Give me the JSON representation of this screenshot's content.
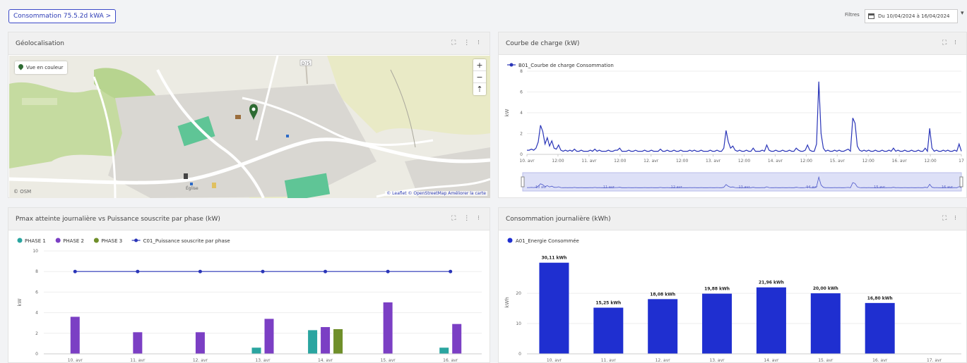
{
  "header": {
    "main_button": "Consommation 75.5.2d kWA >",
    "filter_label": "Filtres",
    "date_range": "Du 10/04/2024 à 16/04/2024"
  },
  "map_panel": {
    "title": "Géolocalisation",
    "tools": "⛶ ⋮ ⁝",
    "layer_button": "Vue en couleur",
    "zoom_in": "+",
    "zoom_out": "−",
    "reset": "⇡",
    "attribution": "© Leaflet © OpenStreetMap Améliorer la carte",
    "logo": "© OSM",
    "place_1": "D75",
    "place_2": "Église",
    "colors": {
      "land": "#ecebe3",
      "buildings": "#d9d7d2",
      "roads": "#ffffff",
      "green": "#c5dba0",
      "park": "#5fc596",
      "marker": "#2e6b33"
    }
  },
  "courbe_panel": {
    "title": "Courbe de charge (kW)",
    "tools": "⛶ ⁝",
    "ylabel": "kW",
    "legend": "B01_Courbe de charge Consommation",
    "y_ticks": [
      "0",
      "2",
      "4",
      "6",
      "8"
    ],
    "x_ticks": [
      "10. avr",
      "12:00",
      "11. avr",
      "12:00",
      "12. avr",
      "12:00",
      "13. avr",
      "12:00",
      "14. avr",
      "12:00",
      "15. avr",
      "12:00",
      "16. avr",
      "12:00",
      "17"
    ],
    "color": "#2a35b8",
    "navigator_ticks": [
      "10 avr",
      "11 avr",
      "12 avr",
      "13 avr",
      "14 avr",
      "15 avr",
      "16 avr"
    ]
  },
  "pmax_panel": {
    "title": "Pmax atteinte journalière vs Puissance souscrite par phase (kW)",
    "tools": "⛶ ⋮ ⁝",
    "ylabel": "kW",
    "legend": [
      {
        "name": "PHASE 1",
        "color": "#2aa5a0"
      },
      {
        "name": "PHASE 2",
        "color": "#7b3fc4"
      },
      {
        "name": "PHASE 3",
        "color": "#6f8f2a"
      },
      {
        "name": "C01_Puissance souscrite par phase",
        "color": "#2a35b8"
      }
    ],
    "y_ticks": [
      "0",
      "2",
      "4",
      "6",
      "8",
      "10"
    ],
    "x_ticks": [
      "10. avr",
      "11. avr",
      "12. avr",
      "13. avr",
      "14. avr",
      "15. avr",
      "16. avr"
    ]
  },
  "conso_panel": {
    "title": "Consommation journalière (kWh)",
    "tools": "⛶ ⁝",
    "ylabel": "kWh",
    "legend": "A01_Energie Consommée",
    "color": "#1f2fd0",
    "y_ticks": [
      "0",
      "10",
      "20"
    ],
    "x_ticks": [
      "10. avr",
      "11. avr",
      "12. avr",
      "13. avr",
      "14. avr",
      "15. avr",
      "16. avr",
      "17. avr"
    ],
    "bar_labels": [
      "30,11 kWh",
      "15,25 kWh",
      "18,08 kWh",
      "19,88 kWh",
      "21,96 kWh",
      "20,00 kWh",
      "16,80 kWh",
      ""
    ]
  },
  "chart_data": [
    {
      "type": "line",
      "title": "Courbe de charge (kW)",
      "ylabel": "kW",
      "ylim": [
        0,
        8
      ],
      "series": [
        {
          "name": "B01_Courbe de charge Consommation",
          "values": [
            0.4,
            0.4,
            0.5,
            0.4,
            0.6,
            1.2,
            2.8,
            2.2,
            1.0,
            1.6,
            0.8,
            1.3,
            0.6,
            0.5,
            0.9,
            0.4,
            0.3,
            0.4,
            0.3,
            0.4,
            0.3,
            0.5,
            0.3,
            0.3,
            0.4,
            0.3,
            0.3,
            0.3,
            0.4,
            0.3,
            0.5,
            0.3,
            0.4,
            0.3,
            0.3,
            0.3,
            0.4,
            0.3,
            0.3,
            0.4,
            0.4,
            0.6,
            0.3,
            0.3,
            0.3,
            0.4,
            0.3,
            0.3,
            0.4,
            0.3,
            0.3,
            0.3,
            0.4,
            0.3,
            0.3,
            0.4,
            0.3,
            0.3,
            0.3,
            0.5,
            0.3,
            0.3,
            0.4,
            0.3,
            0.3,
            0.4,
            0.3,
            0.3,
            0.4,
            0.3,
            0.3,
            0.3,
            0.4,
            0.3,
            0.4,
            0.3,
            0.3,
            0.4,
            0.3,
            0.3,
            0.3,
            0.4,
            0.3,
            0.3,
            0.4,
            0.3,
            0.3,
            0.6,
            2.3,
            1.2,
            0.6,
            0.8,
            0.4,
            0.3,
            0.4,
            0.3,
            0.3,
            0.4,
            0.3,
            0.3,
            0.6,
            0.3,
            0.3,
            0.3,
            0.4,
            0.3,
            0.9,
            0.4,
            0.3,
            0.3,
            0.4,
            0.3,
            0.3,
            0.4,
            0.3,
            0.3,
            0.4,
            0.3,
            0.3,
            0.6,
            0.4,
            0.3,
            0.3,
            0.4,
            0.9,
            0.4,
            0.3,
            0.3,
            1.0,
            7.0,
            2.0,
            0.6,
            0.3,
            0.4,
            0.3,
            0.3,
            0.4,
            0.3,
            0.4,
            0.3,
            0.3,
            0.4,
            0.5,
            0.3,
            3.5,
            3.0,
            0.8,
            0.4,
            0.3,
            0.4,
            0.3,
            0.4,
            0.3,
            0.3,
            0.4,
            0.3,
            0.3,
            0.4,
            0.3,
            0.3,
            0.4,
            0.3,
            0.6,
            0.3,
            0.4,
            0.3,
            0.3,
            0.4,
            0.3,
            0.3,
            0.4,
            0.3,
            0.3,
            0.4,
            0.3,
            0.3,
            0.6,
            0.3,
            2.5,
            0.6,
            0.3,
            0.4,
            0.3,
            0.3,
            0.4,
            0.3,
            0.4,
            0.3,
            0.3,
            0.4,
            0.3,
            1.0,
            0.3
          ]
        }
      ]
    },
    {
      "type": "bar",
      "title": "Pmax atteinte journalière vs Puissance souscrite par phase (kW)",
      "ylabel": "kW",
      "ylim": [
        0,
        10
      ],
      "categories": [
        "10. avr",
        "11. avr",
        "12. avr",
        "13. avr",
        "14. avr",
        "15. avr",
        "16. avr"
      ],
      "series": [
        {
          "name": "PHASE 1",
          "values": [
            0,
            0,
            0,
            0.6,
            2.3,
            0,
            0.6
          ]
        },
        {
          "name": "PHASE 2",
          "values": [
            3.6,
            2.1,
            2.1,
            3.4,
            2.6,
            5.0,
            2.9
          ]
        },
        {
          "name": "PHASE 3",
          "values": [
            0,
            0,
            0,
            0,
            2.4,
            0,
            0
          ]
        },
        {
          "name": "C01_Puissance souscrite par phase",
          "type": "line",
          "values": [
            8,
            8,
            8,
            8,
            8,
            8,
            8
          ]
        }
      ]
    },
    {
      "type": "bar",
      "title": "Consommation journalière (kWh)",
      "ylabel": "kWh",
      "ylim": [
        0,
        30
      ],
      "categories": [
        "10. avr",
        "11. avr",
        "12. avr",
        "13. avr",
        "14. avr",
        "15. avr",
        "16. avr"
      ],
      "series": [
        {
          "name": "A01_Energie Consommée",
          "values": [
            30.11,
            15.25,
            18.08,
            19.88,
            21.96,
            20.0,
            16.8
          ]
        }
      ]
    }
  ]
}
